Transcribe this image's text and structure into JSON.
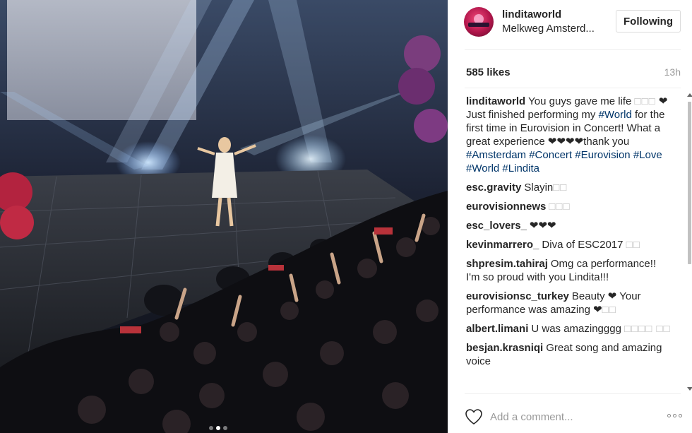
{
  "post": {
    "username": "linditaworld",
    "location": "Melkweg Amsterd...",
    "follow_label": "Following",
    "likes": "585 likes",
    "time_ago": "13h",
    "carousel": {
      "total": 3,
      "active_index": 1
    }
  },
  "caption": {
    "user": "linditaworld",
    "text_1": "You guys gave me life ",
    "emoji_1": "□□□",
    "text_2": " ❤ Just finished performing my ",
    "tag_1": "#World",
    "text_3": " for the first time in Eurovision in Concert! What a great experience ❤❤❤❤thank you ",
    "tag_2": "#Amsterdam",
    "tag_3": "#Concert",
    "tag_4": "#Eurovision",
    "tag_5": "#Love",
    "tag_6": "#World",
    "tag_7": "#Lindita"
  },
  "comments": [
    {
      "user": "esc.gravity",
      "text": "Slayin",
      "emoji": "□□"
    },
    {
      "user": "eurovisionnews",
      "text": "",
      "emoji": "□□□"
    },
    {
      "user": "esc_lovers_",
      "text": "❤❤❤",
      "emoji": ""
    },
    {
      "user": "kevinmarrero_",
      "text": "Diva of ESC2017 ",
      "emoji": "□□"
    },
    {
      "user": "shpresim.tahiraj",
      "text": "Omg ca performance!! I'm so proud with you Lindita!!!",
      "emoji": ""
    },
    {
      "user": "eurovisionsc_turkey",
      "text": "Beauty ❤ Your performance was amazing ❤",
      "emoji": "□□"
    },
    {
      "user": "albert.limani",
      "text": "U was amazingggg ",
      "emoji": "□□□□ □□"
    },
    {
      "user": "besjan.krasniqi",
      "text": "Great song and amazing voice",
      "emoji": ""
    }
  ],
  "footer": {
    "comment_placeholder": "Add a comment..."
  },
  "icons": {
    "like": "heart-outline-icon",
    "more": "more-options-icon"
  },
  "colors": {
    "hashtag": "#003569",
    "border": "#dbdbdb",
    "muted": "#999999"
  }
}
